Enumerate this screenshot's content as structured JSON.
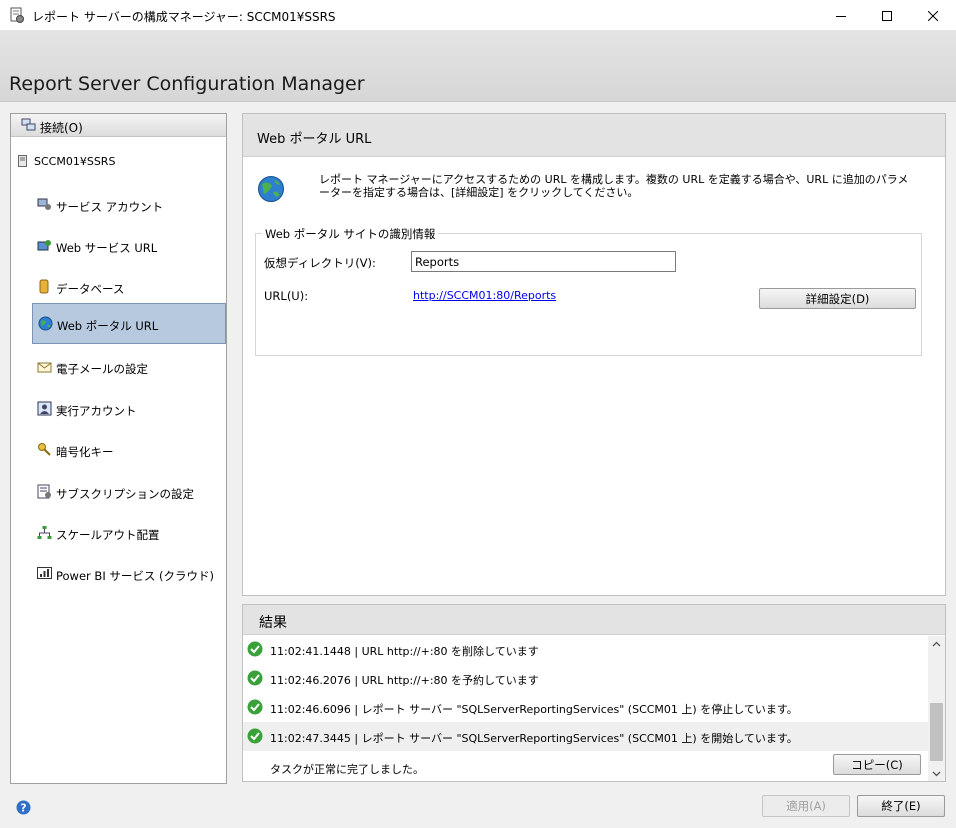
{
  "window": {
    "title": "レポート サーバーの構成マネージャー: SCCM01¥SSRS",
    "app_title": "Report Server Configuration Manager"
  },
  "sidebar": {
    "connect_label": "接続(O)",
    "server": "SCCM01¥SSRS",
    "items": [
      {
        "label": "サービス アカウント",
        "icon": "service-account-icon"
      },
      {
        "label": "Web サービス URL",
        "icon": "web-service-icon"
      },
      {
        "label": "データベース",
        "icon": "database-icon"
      },
      {
        "label": "Web ポータル URL",
        "icon": "globe-icon",
        "selected": true
      },
      {
        "label": "電子メールの設定",
        "icon": "email-icon"
      },
      {
        "label": "実行アカウント",
        "icon": "execution-account-icon"
      },
      {
        "label": "暗号化キー",
        "icon": "key-icon"
      },
      {
        "label": "サブスクリプションの設定",
        "icon": "subscription-icon"
      },
      {
        "label": "スケールアウト配置",
        "icon": "scale-out-icon"
      },
      {
        "label": "Power BI サービス (クラウド)",
        "icon": "power-bi-icon"
      }
    ]
  },
  "content": {
    "title": "Web ポータル URL",
    "description": "レポート マネージャーにアクセスするための URL を構成します。複数の URL を定義する場合や、URL に追加のパラメーターを指定する場合は、[詳細設定] をクリックしてください。",
    "group_label": "Web ポータル サイトの識別情報",
    "vdir_label": "仮想ディレクトリ(V):",
    "vdir_value": "Reports",
    "url_label": "URL(U):",
    "url_value": "http://SCCM01:80/Reports",
    "advanced_button": "詳細設定(D)"
  },
  "results": {
    "title": "結果",
    "rows": [
      "11:02:41.1448 | URL http://+:80 を削除しています",
      "11:02:46.2076 | URL http://+:80 を予約しています",
      "11:02:46.6096 | レポート サーバー \"SQLServerReportingServices\" (SCCM01 上) を停止しています。",
      "11:02:47.3445 | レポート サーバー \"SQLServerReportingServices\" (SCCM01 上) を開始しています。"
    ],
    "done_text": "タスクが正常に完了しました。",
    "copy_button": "コピー(C)"
  },
  "footer": {
    "apply_button": "適用(A)",
    "exit_button": "終了(E)"
  },
  "colors": {
    "selection": "#b7c9df",
    "success_green": "#3aa13a",
    "link": "#0000ee"
  }
}
